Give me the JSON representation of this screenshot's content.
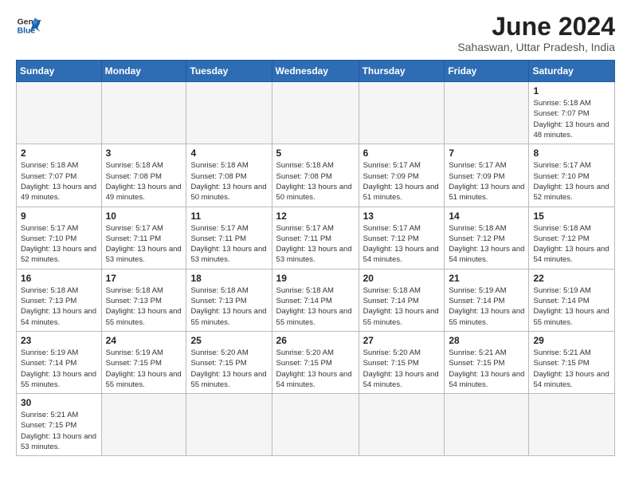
{
  "logo": {
    "text_general": "General",
    "text_blue": "Blue"
  },
  "title": "June 2024",
  "subtitle": "Sahaswan, Uttar Pradesh, India",
  "days_of_week": [
    "Sunday",
    "Monday",
    "Tuesday",
    "Wednesday",
    "Thursday",
    "Friday",
    "Saturday"
  ],
  "weeks": [
    [
      {
        "day": "",
        "empty": true
      },
      {
        "day": "",
        "empty": true
      },
      {
        "day": "",
        "empty": true
      },
      {
        "day": "",
        "empty": true
      },
      {
        "day": "",
        "empty": true
      },
      {
        "day": "",
        "empty": true
      },
      {
        "day": "1",
        "sunrise": "5:18 AM",
        "sunset": "7:07 PM",
        "daylight": "13 hours and 48 minutes."
      }
    ],
    [
      {
        "day": "2",
        "sunrise": "5:18 AM",
        "sunset": "7:07 PM",
        "daylight": "13 hours and 49 minutes."
      },
      {
        "day": "3",
        "sunrise": "5:18 AM",
        "sunset": "7:08 PM",
        "daylight": "13 hours and 49 minutes."
      },
      {
        "day": "4",
        "sunrise": "5:18 AM",
        "sunset": "7:08 PM",
        "daylight": "13 hours and 50 minutes."
      },
      {
        "day": "5",
        "sunrise": "5:18 AM",
        "sunset": "7:08 PM",
        "daylight": "13 hours and 50 minutes."
      },
      {
        "day": "6",
        "sunrise": "5:17 AM",
        "sunset": "7:09 PM",
        "daylight": "13 hours and 51 minutes."
      },
      {
        "day": "7",
        "sunrise": "5:17 AM",
        "sunset": "7:09 PM",
        "daylight": "13 hours and 51 minutes."
      },
      {
        "day": "8",
        "sunrise": "5:17 AM",
        "sunset": "7:10 PM",
        "daylight": "13 hours and 52 minutes."
      }
    ],
    [
      {
        "day": "9",
        "sunrise": "5:17 AM",
        "sunset": "7:10 PM",
        "daylight": "13 hours and 52 minutes."
      },
      {
        "day": "10",
        "sunrise": "5:17 AM",
        "sunset": "7:11 PM",
        "daylight": "13 hours and 53 minutes."
      },
      {
        "day": "11",
        "sunrise": "5:17 AM",
        "sunset": "7:11 PM",
        "daylight": "13 hours and 53 minutes."
      },
      {
        "day": "12",
        "sunrise": "5:17 AM",
        "sunset": "7:11 PM",
        "daylight": "13 hours and 53 minutes."
      },
      {
        "day": "13",
        "sunrise": "5:17 AM",
        "sunset": "7:12 PM",
        "daylight": "13 hours and 54 minutes."
      },
      {
        "day": "14",
        "sunrise": "5:18 AM",
        "sunset": "7:12 PM",
        "daylight": "13 hours and 54 minutes."
      },
      {
        "day": "15",
        "sunrise": "5:18 AM",
        "sunset": "7:12 PM",
        "daylight": "13 hours and 54 minutes."
      }
    ],
    [
      {
        "day": "16",
        "sunrise": "5:18 AM",
        "sunset": "7:13 PM",
        "daylight": "13 hours and 54 minutes."
      },
      {
        "day": "17",
        "sunrise": "5:18 AM",
        "sunset": "7:13 PM",
        "daylight": "13 hours and 55 minutes."
      },
      {
        "day": "18",
        "sunrise": "5:18 AM",
        "sunset": "7:13 PM",
        "daylight": "13 hours and 55 minutes."
      },
      {
        "day": "19",
        "sunrise": "5:18 AM",
        "sunset": "7:14 PM",
        "daylight": "13 hours and 55 minutes."
      },
      {
        "day": "20",
        "sunrise": "5:18 AM",
        "sunset": "7:14 PM",
        "daylight": "13 hours and 55 minutes."
      },
      {
        "day": "21",
        "sunrise": "5:19 AM",
        "sunset": "7:14 PM",
        "daylight": "13 hours and 55 minutes."
      },
      {
        "day": "22",
        "sunrise": "5:19 AM",
        "sunset": "7:14 PM",
        "daylight": "13 hours and 55 minutes."
      }
    ],
    [
      {
        "day": "23",
        "sunrise": "5:19 AM",
        "sunset": "7:14 PM",
        "daylight": "13 hours and 55 minutes."
      },
      {
        "day": "24",
        "sunrise": "5:19 AM",
        "sunset": "7:15 PM",
        "daylight": "13 hours and 55 minutes."
      },
      {
        "day": "25",
        "sunrise": "5:20 AM",
        "sunset": "7:15 PM",
        "daylight": "13 hours and 55 minutes."
      },
      {
        "day": "26",
        "sunrise": "5:20 AM",
        "sunset": "7:15 PM",
        "daylight": "13 hours and 54 minutes."
      },
      {
        "day": "27",
        "sunrise": "5:20 AM",
        "sunset": "7:15 PM",
        "daylight": "13 hours and 54 minutes."
      },
      {
        "day": "28",
        "sunrise": "5:21 AM",
        "sunset": "7:15 PM",
        "daylight": "13 hours and 54 minutes."
      },
      {
        "day": "29",
        "sunrise": "5:21 AM",
        "sunset": "7:15 PM",
        "daylight": "13 hours and 54 minutes."
      }
    ],
    [
      {
        "day": "30",
        "sunrise": "5:21 AM",
        "sunset": "7:15 PM",
        "daylight": "13 hours and 53 minutes."
      },
      {
        "day": "",
        "empty": true
      },
      {
        "day": "",
        "empty": true
      },
      {
        "day": "",
        "empty": true
      },
      {
        "day": "",
        "empty": true
      },
      {
        "day": "",
        "empty": true
      },
      {
        "day": "",
        "empty": true
      }
    ]
  ]
}
